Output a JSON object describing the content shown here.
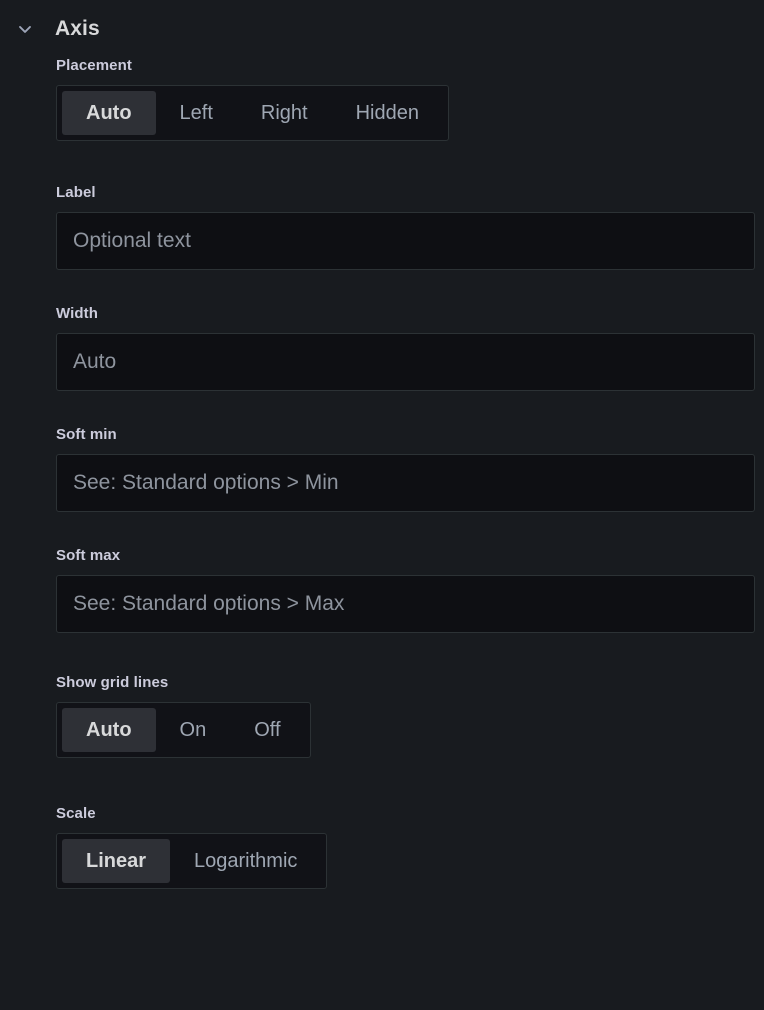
{
  "section": {
    "title": "Axis",
    "collapse_icon": "chevron-down-icon",
    "expanded": true
  },
  "colors": {
    "background": "#181b1f",
    "input_background": "#0e0f13",
    "group_background": "#111217",
    "selected_pill": "#2e3036",
    "border": "#2c3235",
    "text_primary": "#ccccdc",
    "text_muted": "#9fa7b3",
    "placeholder": "#8e949e"
  },
  "fields": {
    "placement": {
      "label": "Placement",
      "options": [
        "Auto",
        "Left",
        "Right",
        "Hidden"
      ],
      "selected": "Auto"
    },
    "axis_label": {
      "label": "Label",
      "value": "",
      "placeholder": "Optional text"
    },
    "width": {
      "label": "Width",
      "value": "",
      "placeholder": "Auto"
    },
    "soft_min": {
      "label": "Soft min",
      "value": "",
      "placeholder": "See: Standard options > Min"
    },
    "soft_max": {
      "label": "Soft max",
      "value": "",
      "placeholder": "See: Standard options > Max"
    },
    "show_grid_lines": {
      "label": "Show grid lines",
      "options": [
        "Auto",
        "On",
        "Off"
      ],
      "selected": "Auto"
    },
    "scale": {
      "label": "Scale",
      "options": [
        "Linear",
        "Logarithmic"
      ],
      "selected": "Linear"
    }
  }
}
